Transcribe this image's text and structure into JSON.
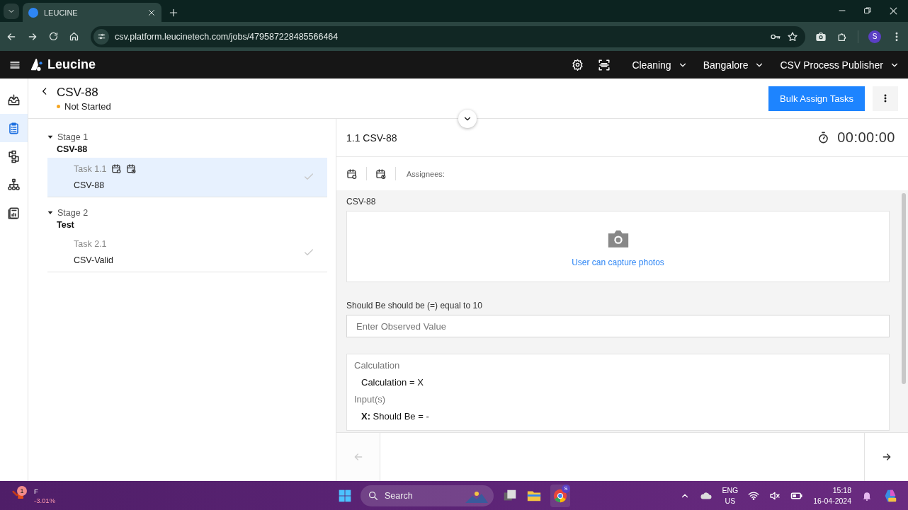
{
  "browser": {
    "tab_title": "LEUCINE",
    "url": "csv.platform.leucinetech.com/jobs/479587228485566464",
    "profile_initial": "S"
  },
  "app_header": {
    "brand": "Leucine",
    "menus": [
      "Cleaning",
      "Bangalore",
      "CSV Process Publisher"
    ]
  },
  "nav": [
    {
      "selected": false
    },
    {
      "selected": true
    },
    {
      "selected": false
    },
    {
      "selected": false
    },
    {
      "selected": false
    }
  ],
  "job": {
    "title": "CSV-88",
    "status": "Not Started",
    "primary_action": "Bulk Assign Tasks"
  },
  "stages": [
    {
      "label": "Stage 1",
      "name": "CSV-88",
      "expanded": true,
      "tasks": [
        {
          "label": "Task 1.1",
          "name": "CSV-88",
          "selected": true,
          "scheduled": true
        }
      ]
    },
    {
      "label": "Stage 2",
      "name": "Test",
      "expanded": true,
      "tasks": [
        {
          "label": "Task 2.1",
          "name": "CSV-Valid",
          "selected": false,
          "scheduled": false
        }
      ]
    }
  ],
  "task_panel": {
    "title": "1.1 CSV-88",
    "timer": "00:00:00",
    "assignees_label": "Assignees:",
    "parameters": [
      {
        "kind": "media",
        "label": "CSV-88",
        "hint": "User can capture photos"
      },
      {
        "kind": "number",
        "label": "Should Be should be (=) equal to 10",
        "placeholder": "Enter Observed Value"
      },
      {
        "kind": "calculation",
        "label": "Calculation",
        "expression": "Calculation = X",
        "inputs_label": "Input(s)",
        "inputs": [
          {
            "variable": "X:",
            "text": "Should Be = -"
          }
        ]
      }
    ],
    "footer_buttons": [
      {
        "kind": "previous",
        "disabled": true
      },
      {
        "kind": "next",
        "disabled": false
      }
    ]
  },
  "taskbar": {
    "stock_badge": "1",
    "stock_name": "F",
    "stock_change": "-3.01%",
    "search": "Search",
    "chrome_badge": "S",
    "language": "ENG",
    "region": "US",
    "time": "15:18",
    "date": "16-04-2024"
  }
}
